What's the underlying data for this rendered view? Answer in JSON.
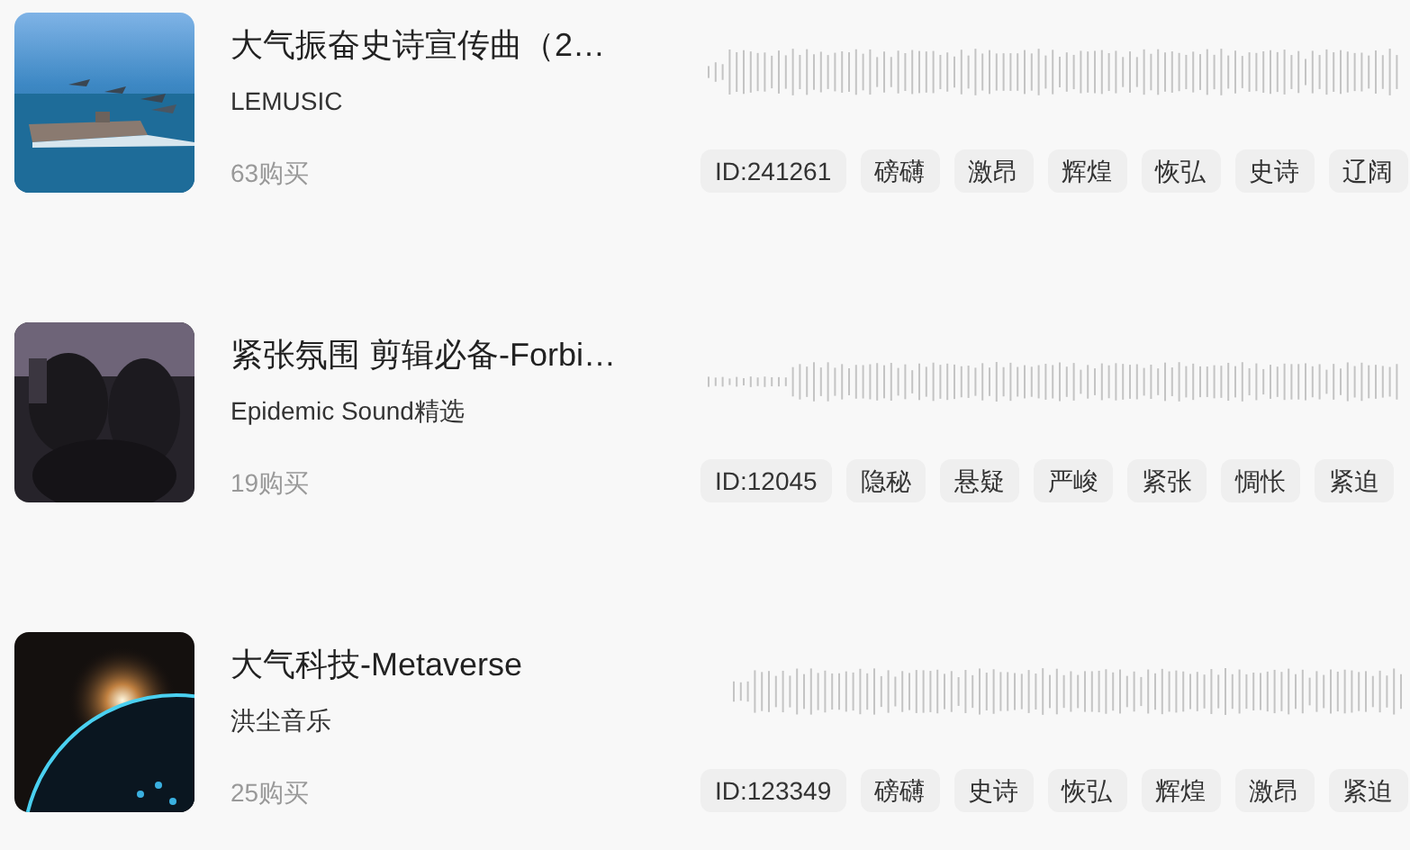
{
  "tracks": [
    {
      "title": "大气振奋史诗宣传曲（2…",
      "artist": "LEMUSIC",
      "purchases": "63购买",
      "id": "ID:241261",
      "tags": [
        "磅礴",
        "激昂",
        "辉煌",
        "恢弘",
        "史诗",
        "辽阔"
      ]
    },
    {
      "title": "紧张氛围 剪辑必备-Forbi…",
      "artist": "Epidemic Sound精选",
      "purchases": "19购买",
      "id": "ID:12045",
      "tags": [
        "隐秘",
        "悬疑",
        "严峻",
        "紧张",
        "惆怅",
        "紧迫"
      ]
    },
    {
      "title": "大气科技-Metaverse",
      "artist": "洪尘音乐",
      "purchases": "25购买",
      "id": "ID:123349",
      "tags": [
        "磅礴",
        "史诗",
        "恢弘",
        "辉煌",
        "激昂",
        "紧迫"
      ]
    }
  ]
}
